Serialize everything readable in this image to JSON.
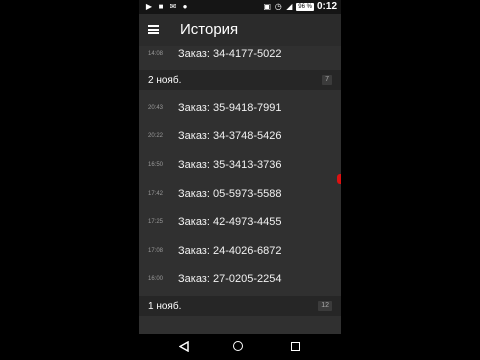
{
  "status_bar": {
    "time": "0:12",
    "battery": "96 %",
    "icons": [
      "play-icon",
      "video-icon",
      "mail-icon",
      "messenger-icon",
      "notification-icon",
      "alarm-icon",
      "wifi-icon",
      "signal-icon",
      "battery-icon"
    ]
  },
  "toolbar": {
    "title": "История"
  },
  "list": {
    "top_item": {
      "time": "14:08",
      "order": "Заказ: 34-4177-5022"
    },
    "groups": [
      {
        "date": "2 нояб.",
        "count": "7",
        "items": [
          {
            "time": "20:43",
            "order": "Заказ: 35-9418-7991"
          },
          {
            "time": "20:22",
            "order": "Заказ: 34-3748-5426"
          },
          {
            "time": "16:50",
            "order": "Заказ: 35-3413-3736"
          },
          {
            "time": "17:42",
            "order": "Заказ: 05-5973-5588"
          },
          {
            "time": "17:25",
            "order": "Заказ: 42-4973-4455"
          },
          {
            "time": "17:08",
            "order": "Заказ: 24-4026-6872"
          },
          {
            "time": "16:00",
            "order": "Заказ: 27-0205-2254"
          }
        ]
      },
      {
        "date": "1 нояб.",
        "count": "12",
        "items": []
      }
    ]
  },
  "colors": {
    "background": "#303030",
    "toolbar": "#2b2b2b",
    "header": "#262626",
    "marker": "#dd1111"
  }
}
